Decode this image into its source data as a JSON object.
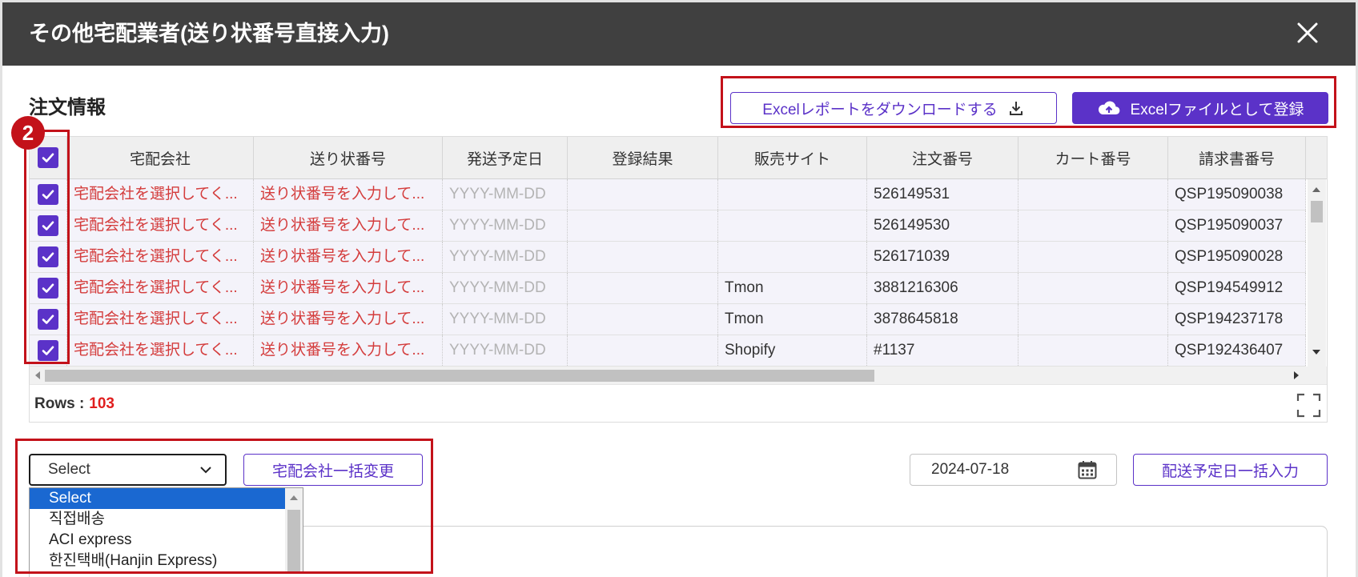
{
  "modal": {
    "title": "その他宅配業者(送り状番号直接入力)",
    "close_icon": "close-icon"
  },
  "order_section": {
    "title": "注文情報"
  },
  "toolbar": {
    "download_label": "Excelレポートをダウンロードする",
    "download_icon": "download-icon",
    "upload_label": "Excelファイルとして登録",
    "upload_icon": "cloud-upload-icon"
  },
  "annotation": {
    "step_badge": "2"
  },
  "table": {
    "select_all_checked": true,
    "columns": [
      "宅配会社",
      "送り状番号",
      "発送予定日",
      "登録結果",
      "販売サイト",
      "注文番号",
      "カート番号",
      "請求書番号"
    ],
    "rows": [
      {
        "checked": true,
        "carrier": "宅配会社を選択してく...",
        "tracking_no": "送り状番号を入力して...",
        "ship_date": "YYYY-MM-DD",
        "result": "",
        "sales_site": "",
        "order_no": "526149531",
        "cart_no": "",
        "invoice_no": "QSP195090038"
      },
      {
        "checked": true,
        "carrier": "宅配会社を選択してく...",
        "tracking_no": "送り状番号を入力して...",
        "ship_date": "YYYY-MM-DD",
        "result": "",
        "sales_site": "",
        "order_no": "526149530",
        "cart_no": "",
        "invoice_no": "QSP195090037"
      },
      {
        "checked": true,
        "carrier": "宅配会社を選択してく...",
        "tracking_no": "送り状番号を入力して...",
        "ship_date": "YYYY-MM-DD",
        "result": "",
        "sales_site": "",
        "order_no": "526171039",
        "cart_no": "",
        "invoice_no": "QSP195090028"
      },
      {
        "checked": true,
        "carrier": "宅配会社を選択してく...",
        "tracking_no": "送り状番号を入力して...",
        "ship_date": "YYYY-MM-DD",
        "result": "",
        "sales_site": "Tmon",
        "order_no": "3881216306",
        "cart_no": "",
        "invoice_no": "QSP194549912"
      },
      {
        "checked": true,
        "carrier": "宅配会社を選択してく...",
        "tracking_no": "送り状番号を入力して...",
        "ship_date": "YYYY-MM-DD",
        "result": "",
        "sales_site": "Tmon",
        "order_no": "3878645818",
        "cart_no": "",
        "invoice_no": "QSP194237178"
      },
      {
        "checked": true,
        "carrier": "宅配会社を選択してく...",
        "tracking_no": "送り状番号を入力して...",
        "ship_date": "YYYY-MM-DD",
        "result": "",
        "sales_site": "Shopify",
        "order_no": "#1137",
        "cart_no": "",
        "invoice_no": "QSP192436407"
      }
    ]
  },
  "footer": {
    "rows_label": "Rows :",
    "rows_count": "103",
    "fullscreen_icon": "fullscreen-icon"
  },
  "bulk_edit": {
    "carrier_select": {
      "value": "Select",
      "highlighted_option": "Select",
      "options": [
        "Select",
        "직접배송",
        "ACI express",
        "한진택배(Hanjin Express)"
      ]
    },
    "carrier_apply_label": "宅配会社一括変更",
    "ship_date_value": "2024-07-18",
    "ship_date_icon": "calendar-icon",
    "ship_date_apply_label": "配送予定日一括入力"
  },
  "colors": {
    "accent": "#5b32c8",
    "modal_header": "#404040",
    "highlight_red": "#c3121a",
    "error_text": "#d43c3c",
    "selected_row_bg": "#f4f3fa",
    "option_highlight": "#1a68d1"
  }
}
